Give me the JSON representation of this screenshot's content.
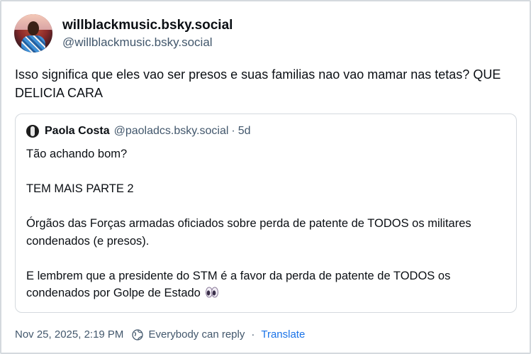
{
  "author": {
    "display_name": "willblackmusic.bsky.social",
    "handle": "@willblackmusic.bsky.social",
    "avatar_icon": "user-avatar-photo"
  },
  "post": {
    "text": "Isso significa que eles vao ser presos e suas familias nao vao mamar nas tetas? QUE DELICIA CARA"
  },
  "quote": {
    "author_name": "Paola Costa",
    "author_handle": "@paoladcs.bsky.social",
    "separator": "·",
    "time_ago": "5d",
    "paragraphs": [
      "Tão achando bom?",
      "TEM MAIS PARTE 2",
      "Órgãos das Forças armadas oficiados sobre perda de patente de TODOS os militares condenados (e presos).",
      "E lembrem que a presidente do STM é a favor da perda de patente de TODOS os condenados por Golpe de Estado"
    ],
    "trailing_emoji": "eyes-icon"
  },
  "footer": {
    "timestamp": "Nov 25, 2025, 2:19 PM",
    "reply_setting": "Everybody can reply",
    "separator": "·",
    "translate_label": "Translate"
  },
  "colors": {
    "text_primary": "#0b0f14",
    "text_secondary": "#42576c",
    "link": "#1a73e8",
    "border": "#d4d9de"
  }
}
